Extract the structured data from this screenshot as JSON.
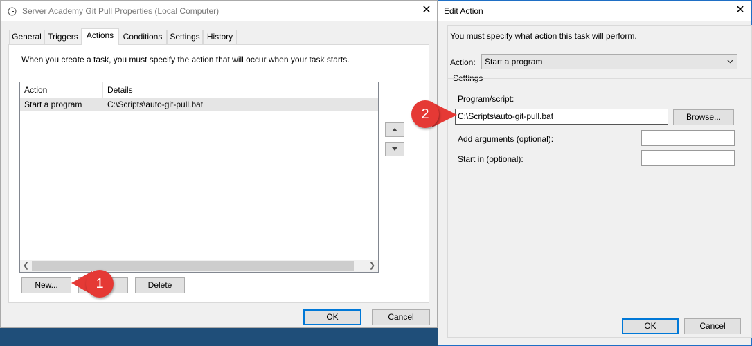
{
  "props": {
    "title": "Server Academy Git Pull Properties (Local Computer)",
    "tabs": [
      "General",
      "Triggers",
      "Actions",
      "Conditions",
      "Settings",
      "History"
    ],
    "intro": "When you create a task, you must specify the action that will occur when your task starts.",
    "table": {
      "headers": [
        "Action",
        "Details"
      ],
      "rows": [
        [
          "Start a program",
          "C:\\Scripts\\auto-git-pull.bat"
        ]
      ]
    },
    "new_label": "New...",
    "delete_label": "Delete",
    "ok_label": "OK",
    "cancel_label": "Cancel"
  },
  "edit": {
    "title": "Edit Action",
    "intro": "You must specify what action this task will perform.",
    "action_label": "Action:",
    "action_value": "Start a program",
    "settings_label": "Settings",
    "program_label": "Program/script:",
    "program_value": "C:\\Scripts\\auto-git-pull.bat",
    "browse_label": "Browse...",
    "args_label": "Add arguments (optional):",
    "startin_label": "Start in (optional):",
    "ok_label": "OK",
    "cancel_label": "Cancel"
  },
  "callouts": {
    "one": "1",
    "two": "2"
  },
  "colors": {
    "accent": "#0078d7",
    "callout": "#e53935",
    "selected_row": "#e5e5e5"
  }
}
